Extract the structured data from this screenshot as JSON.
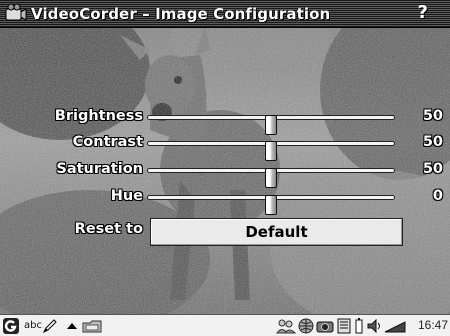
{
  "window": {
    "title": "VideoCorder – Image Configuration",
    "help_label": "?"
  },
  "sliders": [
    {
      "label": "Brightness",
      "value": "50",
      "level": 50
    },
    {
      "label": "Contrast",
      "value": "50",
      "level": 50
    },
    {
      "label": "Saturation",
      "value": "50",
      "level": 50
    },
    {
      "label": "Hue",
      "value": "0",
      "level": 50
    }
  ],
  "reset": {
    "label": "Reset to",
    "button_label": "Default"
  },
  "taskbar": {
    "start_icon": "g-logo-icon",
    "keyboard_label": "abc",
    "clock": "16:47",
    "icons": [
      "pen-icon",
      "arrow-up-icon",
      "folder-icon",
      "people-icon",
      "globe-icon",
      "camera-icon",
      "notes-icon",
      "battery-icon",
      "speaker-icon",
      "signal-icon"
    ]
  }
}
